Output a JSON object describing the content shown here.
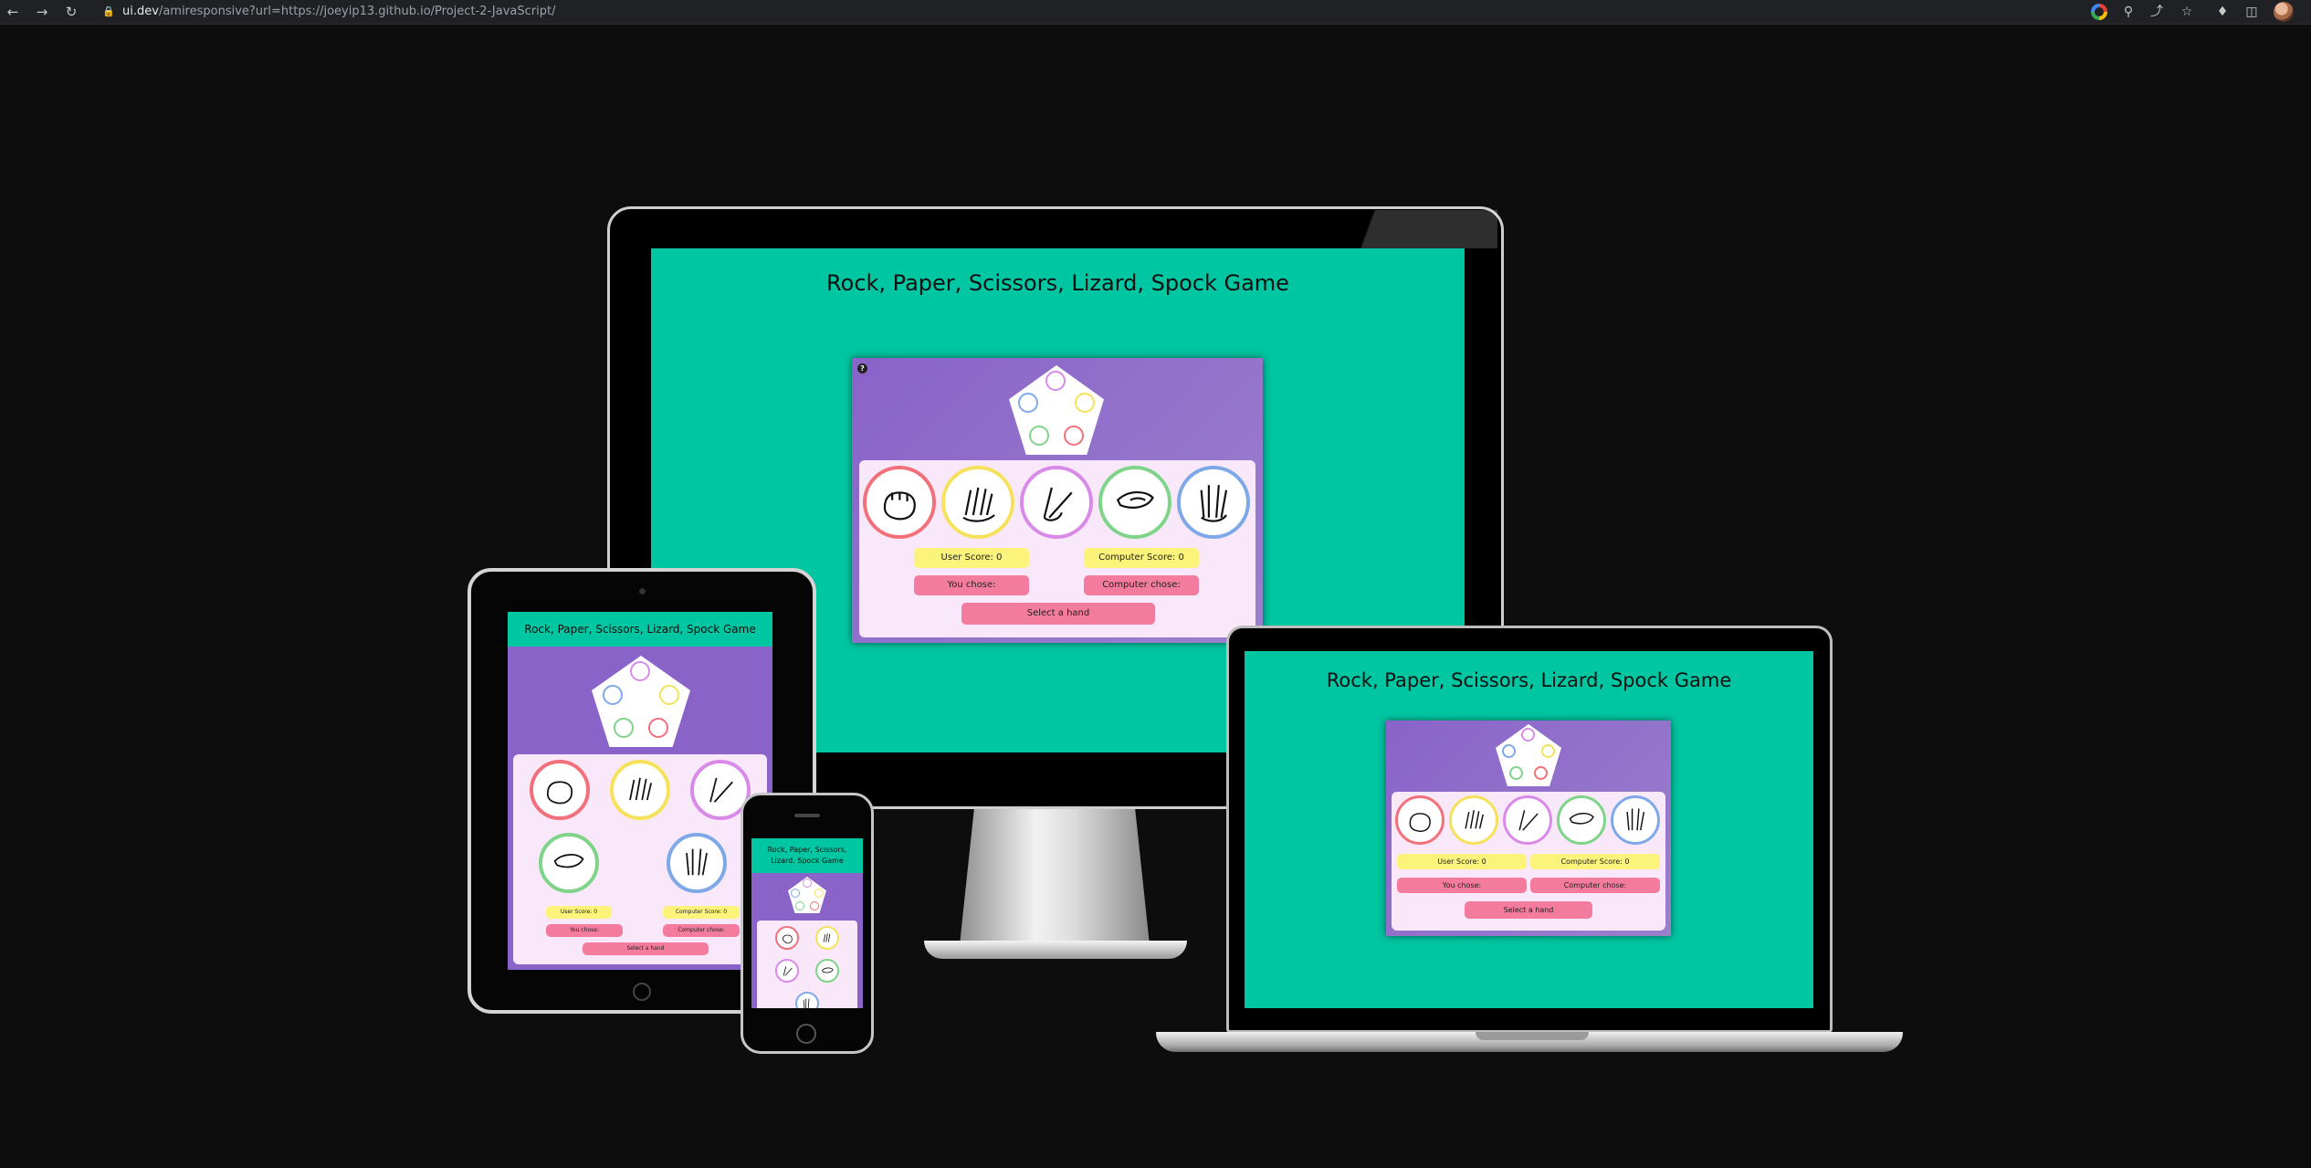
{
  "browser": {
    "url_host": "ui.dev",
    "url_path": "/amiresponsive?url=https://joeyip13.github.io/Project-2-JavaScript/",
    "back_icon": "arrow-left-icon",
    "forward_icon": "arrow-right-icon",
    "reload_icon": "reload-icon"
  },
  "app": {
    "title": "Rock, Paper, Scissors, Lizard, Spock Game",
    "phone_title": "Rock, Paper, Scissors, Lizard, Spock Game",
    "user_score": "User Score: 0",
    "computer_score": "Computer Score: 0",
    "you_chose": "You chose:",
    "computer_chose": "Computer chose:",
    "select_hand": "Select a hand",
    "help_icon_text": "?",
    "hands": [
      {
        "name": "rock",
        "color": "#f2707a"
      },
      {
        "name": "paper",
        "color": "#f5e25a"
      },
      {
        "name": "scissors",
        "color": "#d98ae8"
      },
      {
        "name": "lizard",
        "color": "#7fd48a"
      },
      {
        "name": "spock",
        "color": "#7fa8e8"
      }
    ],
    "colors": {
      "background": "#00c6a2",
      "card_gradient": [
        "#8a63c9",
        "#9b80cd"
      ],
      "inner_panel": "#f8e8f9",
      "score_pill": "#fbf37a",
      "choice_pill": "#f37b9e"
    }
  }
}
